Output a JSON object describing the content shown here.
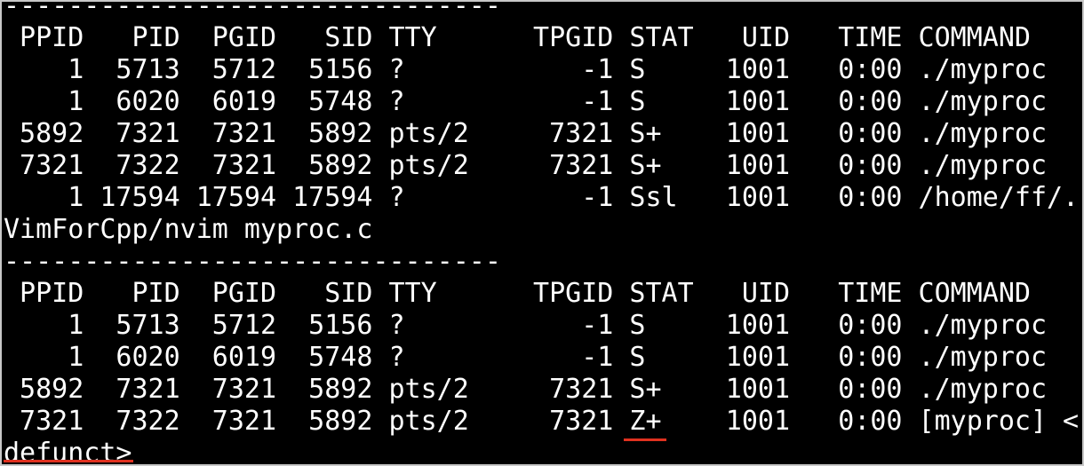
{
  "terminal": {
    "lines": [
      "-------------------------------",
      " PPID   PID  PGID   SID TTY      TPGID STAT   UID   TIME COMMAND",
      "    1  5713  5712  5156 ?           -1 S     1001   0:00 ./myproc",
      "    1  6020  6019  5748 ?           -1 S     1001   0:00 ./myproc",
      " 5892  7321  7321  5892 pts/2     7321 S+    1001   0:00 ./myproc",
      " 7321  7322  7321  5892 pts/2     7321 S+    1001   0:00 ./myproc",
      "    1 17594 17594 17594 ?           -1 Ssl   1001   0:00 /home/ff/.",
      "VimForCpp/nvim myproc.c",
      "-------------------------------",
      " PPID   PID  PGID   SID TTY      TPGID STAT   UID   TIME COMMAND",
      "    1  5713  5712  5156 ?           -1 S     1001   0:00 ./myproc",
      "    1  6020  6019  5748 ?           -1 S     1001   0:00 ./myproc",
      " 5892  7321  7321  5892 pts/2     7321 S+    1001   0:00 ./myproc",
      " 7321  7322  7321  5892 pts/2     7321 Z+    1001   0:00 [myproc] <",
      "defunct>"
    ],
    "colors": {
      "background": "#000000",
      "text": "#ffffff",
      "highlight_underline": "#e0311f",
      "border": "#c8c8c8"
    }
  }
}
